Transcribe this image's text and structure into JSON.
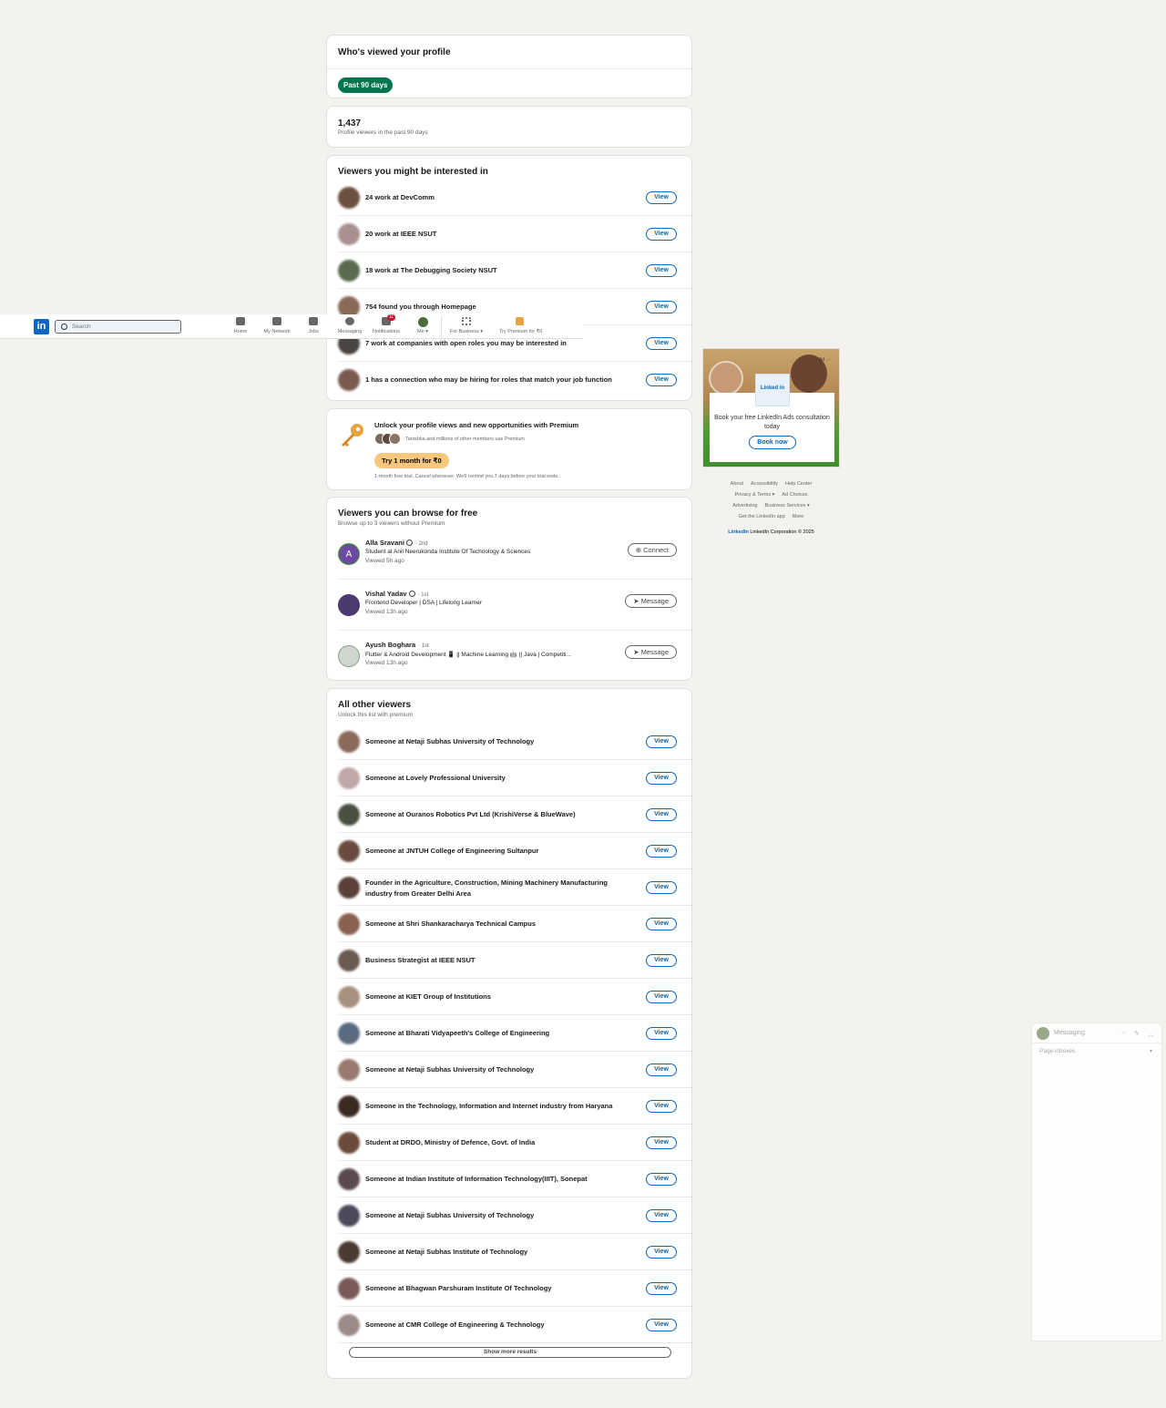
{
  "nav": {
    "search_placeholder": "Search",
    "items": [
      {
        "label": "Home",
        "icon": "home-icon"
      },
      {
        "label": "My Network",
        "icon": "network-icon"
      },
      {
        "label": "Jobs",
        "icon": "briefcase-icon"
      },
      {
        "label": "Messaging",
        "icon": "chat-icon"
      },
      {
        "label": "Notifications",
        "icon": "bell-icon",
        "badge": "11"
      },
      {
        "label": "Me ▾",
        "icon": "avatar"
      },
      {
        "label": "For Business ▾",
        "icon": "grid-icon"
      },
      {
        "label": "Try Premium for ₹0",
        "icon": "premium-icon"
      }
    ]
  },
  "header": {
    "title": "Who's viewed your profile",
    "filter": "Past 90 days"
  },
  "stats": {
    "count": "1,437",
    "caption": "Profile viewers in the past 90 days"
  },
  "interested": {
    "title": "Viewers you might be interested in",
    "rows": [
      {
        "text": "24 work at  DevComm",
        "button": "View"
      },
      {
        "text": "20 work at  IEEE NSUT",
        "button": "View"
      },
      {
        "text": "18 work at  The Debugging Society NSUT",
        "button": "View"
      },
      {
        "text": "754 found you through Homepage",
        "button": "View"
      },
      {
        "text": "7 work at companies with open roles you may be interested in",
        "button": "View"
      },
      {
        "text": "1 has a connection who may be hiring for roles that match your job function",
        "button": "View"
      }
    ]
  },
  "premium": {
    "title": "Unlock your profile views and new opportunities with Premium",
    "members": "Tanishka and millions of other members use Premium",
    "button": "Try 1 month for ₹0",
    "fine_print": "1-month free trial. Cancel whenever. We'll remind you 7 days before your trial ends."
  },
  "browse": {
    "title": "Viewers you can browse for free",
    "subtitle": "Browse up to 3 viewers without Premium",
    "viewers": [
      {
        "name": "Alla Sravani",
        "degree": "· 2nd",
        "headline": "Student at Anil Neerukonda Institute Of Technology & Sciences",
        "when": "Viewed 5h ago",
        "action": "Connect",
        "action_icon": "add-person-icon",
        "initial": "A"
      },
      {
        "name": "Vishal Yadav",
        "degree": "· 1st",
        "headline": "Frontend Developer | DSA | Lifelong Learner",
        "when": "Viewed 13h ago",
        "action": "Message",
        "action_icon": "send-icon"
      },
      {
        "name": "Ayush Boghara",
        "degree": "· 1st",
        "headline": "Flutter & Android Development 📱 || Machine Learning 🤖 || Java | Competiti...",
        "when": "Viewed 13h ago",
        "action": "Message",
        "action_icon": "send-icon"
      }
    ]
  },
  "others": {
    "title": "All other viewers",
    "subtitle": "Unlock this list with premium",
    "rows": [
      "Someone at Netaji Subhas University of Technology",
      "Someone at Lovely Professional University",
      "Someone at Ouranos Robotics Pvt Ltd (KrishiVerse & BlueWave)",
      "Someone at JNTUH College of Engineering Sultanpur",
      "Founder in the Agriculture, Construction, Mining Machinery Manufacturing industry from Greater Delhi Area",
      "Someone at Shri Shankaracharya Technical Campus",
      "Business Strategist at IEEE NSUT",
      "Someone at KIET Group of Institutions",
      "Someone at Bharati Vidyapeeth's College of Engineering",
      "Someone at Netaji Subhas University of Technology",
      "Someone in the Technology, Information and Internet industry from Haryana",
      "Student at DRDO, Ministry of Defence, Govt. of India",
      "Someone at Indian Institute of Information Technology(IIIT), Sonepat",
      "Someone at Netaji Subhas University of Technology",
      "Someone at Netaji Subhas Institute of Technology",
      "Someone at Bhagwan Parshuram Institute Of Technology",
      "Someone at CMR College of Engineering & Technology"
    ],
    "button": "View",
    "show_more": "Show more results"
  },
  "ad": {
    "label": "Ad ···",
    "logo_text": "Linked in",
    "text": "Book your free LinkedIn Ads consultation today",
    "button": "Book now"
  },
  "footer": {
    "line1": [
      "About",
      "Accessibility",
      "Help Center"
    ],
    "line2": [
      "Privacy & Terms ▾",
      "Ad Choices"
    ],
    "line3": [
      "Advertising",
      "Business Services ▾"
    ],
    "line4": [
      "Get the LinkedIn app",
      "More"
    ],
    "brand": "LinkedIn",
    "copyright": "LinkedIn Corporation © 2025"
  },
  "messaging": {
    "title": "Messaging",
    "subtitle": "Page inboxes"
  },
  "colors": {
    "brand": "#0a66c2",
    "green_pill": "#01754f",
    "premium_button": "#f8c77e",
    "badge": "#cb112d"
  }
}
